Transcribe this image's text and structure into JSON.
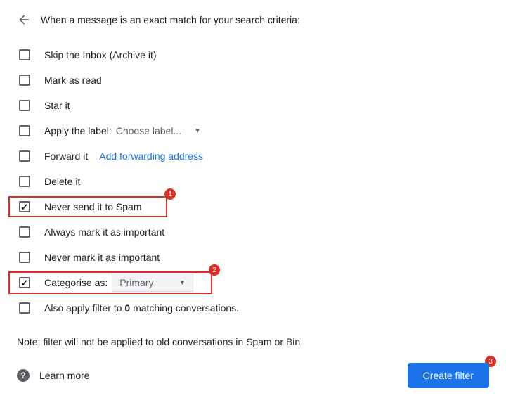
{
  "header": {
    "title": "When a message is an exact match for your search criteria:"
  },
  "options": {
    "skip_inbox": "Skip the Inbox (Archive it)",
    "mark_read": "Mark as read",
    "star": "Star it",
    "apply_label": "Apply the label:",
    "choose_label": "Choose label...",
    "forward": "Forward it",
    "add_forwarding": "Add forwarding address",
    "delete": "Delete it",
    "never_spam": "Never send it to Spam",
    "always_important": "Always mark it as important",
    "never_important": "Never mark it as important",
    "categorise": "Categorise as:",
    "category_selected": "Primary",
    "also_apply_prefix": "Also apply filter to ",
    "also_apply_count": "0",
    "also_apply_suffix": " matching conversations."
  },
  "note": "Note: filter will not be applied to old conversations in Spam or Bin",
  "footer": {
    "learn_more": "Learn more",
    "create_filter": "Create filter"
  },
  "badges": {
    "b1": "1",
    "b2": "2",
    "b3": "3"
  }
}
